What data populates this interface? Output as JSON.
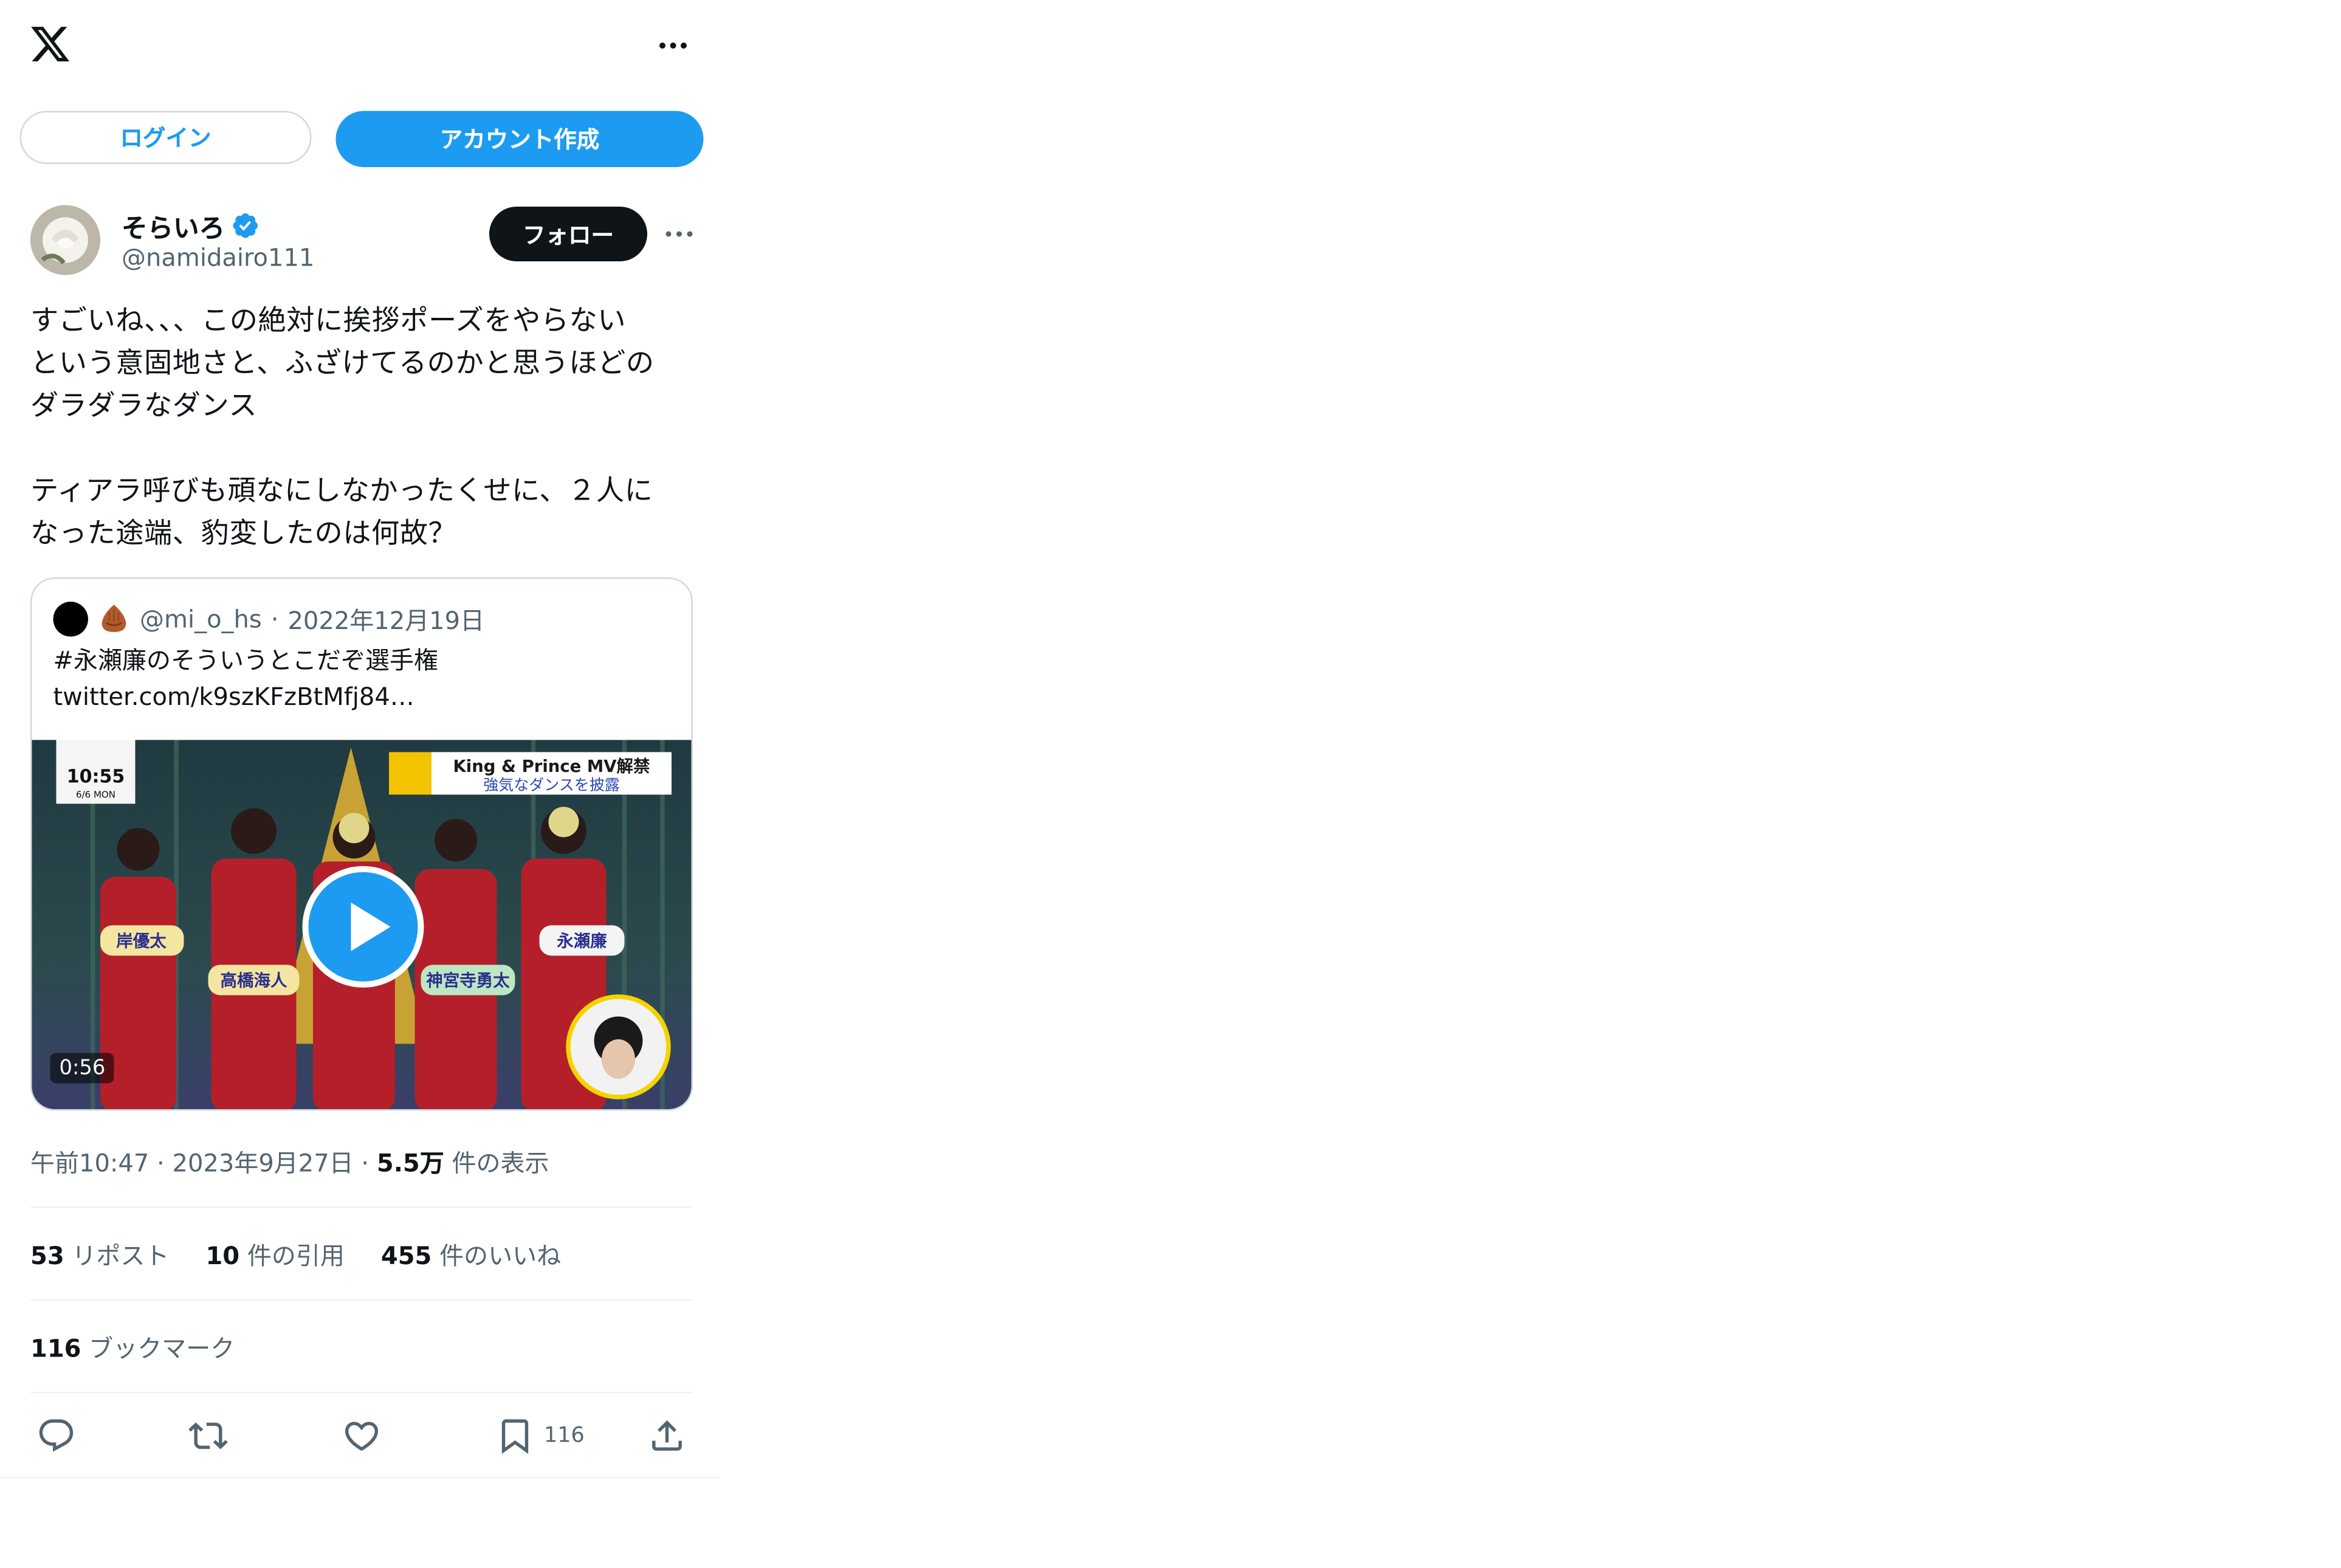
{
  "topbar": {
    "logo_icon": "x-logo-icon",
    "more_icon": "more-horizontal-icon"
  },
  "auth": {
    "login_label": "ログイン",
    "signup_label": "アカウント作成"
  },
  "author": {
    "display_name": "そらいろ",
    "handle": "@namidairo111",
    "verified": true,
    "follow_label": "フォロー"
  },
  "tweet": {
    "text": "すごいね、、、この絶対に挨拶ポーズをやらない\nという意固地さと、ふざけてるのかと思うほどの\nダラダラなダンス\n\nティアラ呼びも頑なにしなかったくせに、２人に\nなった途端、豹変したのは何故？"
  },
  "quote": {
    "handle": "@mi_o_hs",
    "separator": "·",
    "date": "2022年12月19日",
    "text_line1": "#永瀬廉のそういうとこだぞ選手権",
    "text_line2": "twitter.com/k9szKFzBtMfj84…",
    "video_duration": "0:56",
    "caption_top": "King & Prince MV解禁",
    "caption_sub": "強気なダンスを披露",
    "clock_time": "10:55",
    "clock_date": "6/6 MON",
    "name_tags": [
      "岸優太",
      "高橋海人",
      "神宮寺勇太",
      "永瀬廉"
    ]
  },
  "meta": {
    "time": "午前10:47",
    "sep1": "·",
    "date": "2023年9月27日",
    "sep2": "·",
    "views_count": "5.5万",
    "views_label": "件の表示"
  },
  "stats": {
    "reposts_count": "53",
    "reposts_label": "リポスト",
    "quotes_count": "10",
    "quotes_label": "件の引用",
    "likes_count": "455",
    "likes_label": "件のいいね"
  },
  "bookmarks": {
    "count": "116",
    "label": "ブックマーク"
  },
  "actions": {
    "bookmark_count": "116"
  },
  "colors": {
    "accent": "#1d9bf0",
    "text": "#0f1419",
    "muted": "#536471",
    "border": "#cfd9de"
  }
}
